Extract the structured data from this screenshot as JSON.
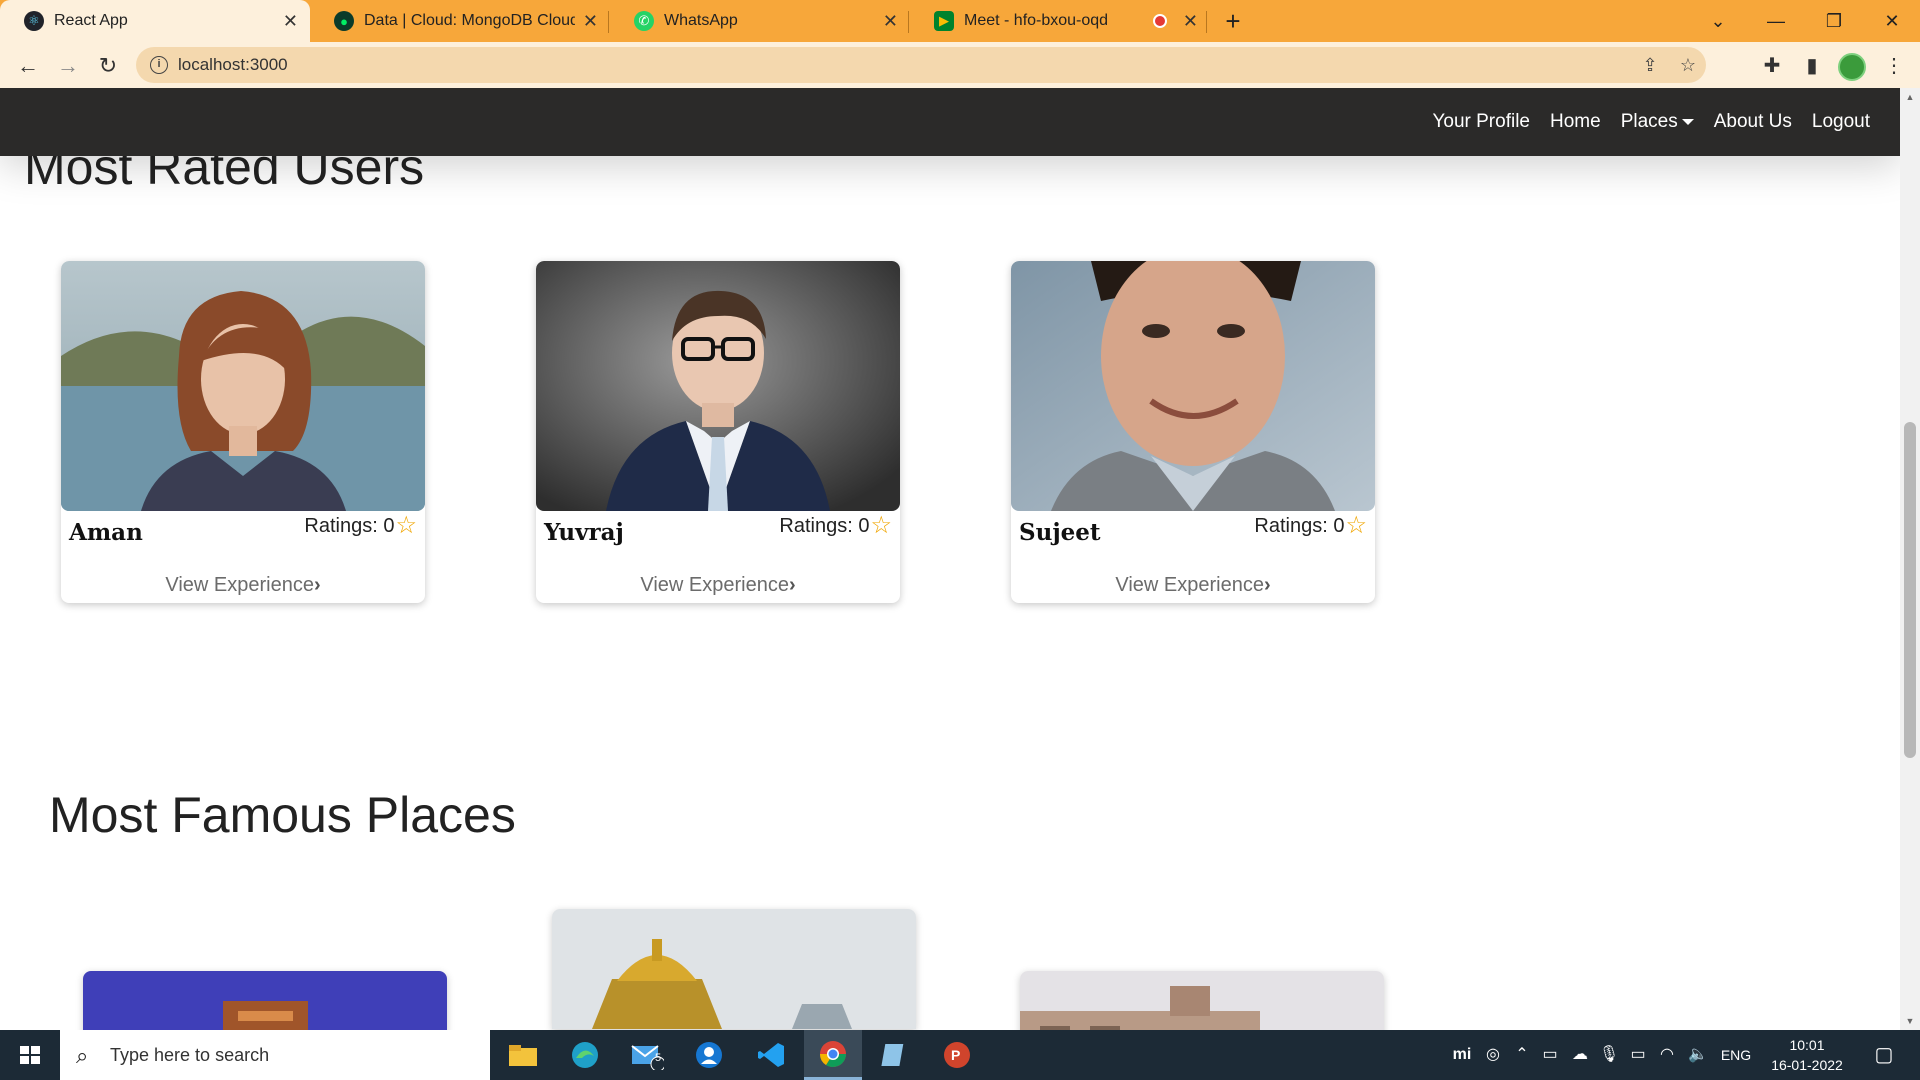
{
  "browser": {
    "tabs": [
      {
        "label": "React App",
        "favicon": "react-icon",
        "active": true
      },
      {
        "label": "Data | Cloud: MongoDB Cloud",
        "favicon": "mongodb-leaf-icon",
        "active": false
      },
      {
        "label": "WhatsApp",
        "favicon": "whatsapp-icon",
        "active": false
      },
      {
        "label": "Meet - hfo-bxou-oqd",
        "favicon": "google-meet-icon",
        "active": false
      }
    ],
    "close_glyph": "✕",
    "new_tab_glyph": "+",
    "address": "localhost:3000"
  },
  "navbar": {
    "links": [
      "Your Profile",
      "Home",
      "Places",
      "About Us",
      "Logout"
    ]
  },
  "sections": {
    "users_title": "Most Rated Users",
    "places_title": "Most Famous Places"
  },
  "users": [
    {
      "name": "Aman",
      "ratings_label": "Ratings: 0",
      "view_label": "View Experience"
    },
    {
      "name": "Yuvraj",
      "ratings_label": "Ratings: 0",
      "view_label": "View Experience"
    },
    {
      "name": "Sujeet",
      "ratings_label": "Ratings: 0",
      "view_label": "View Experience"
    }
  ],
  "taskbar": {
    "search_placeholder": "Type here to search",
    "mail_badge": "5",
    "language": "ENG",
    "time": "10:01",
    "date": "16-01-2022"
  },
  "colors": {
    "tabbar": "#f7a73a",
    "toolbar": "#fdf0dc",
    "navbar": "#2b2a29",
    "star": "#f0a500",
    "taskbar": "#1c2a36"
  }
}
